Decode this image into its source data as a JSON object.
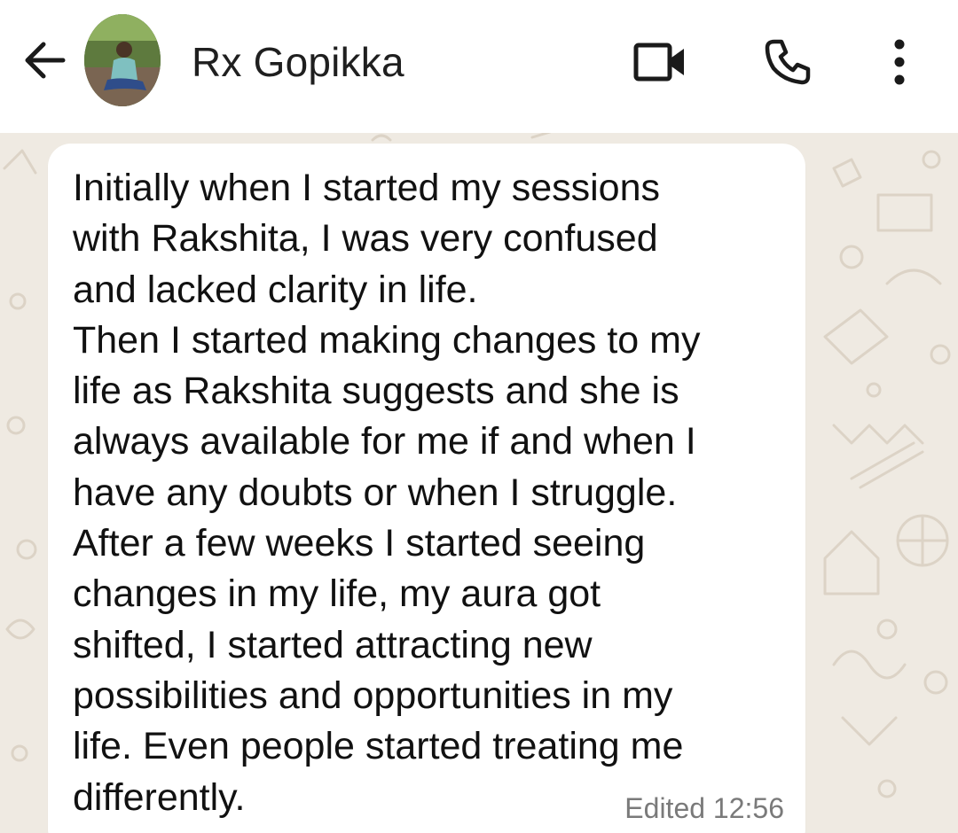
{
  "header": {
    "contact_name": "Rx Gopikka",
    "back_icon": "arrow-left-icon",
    "video_icon": "video-camera-icon",
    "call_icon": "phone-icon",
    "menu_icon": "more-vertical-icon"
  },
  "message": {
    "text": "Initially when I started my sessions\nwith Rakshita, I was very confused\nand lacked clarity in life.\nThen I started making changes to my\nlife as Rakshita suggests and she is\nalways available for me if and when I\nhave any doubts or when I struggle.\nAfter a few weeks I started seeing\nchanges in my life, my aura got\nshifted, I started attracting new\npossibilities and opportunities in my\nlife. Even people started treating me\ndifferently.",
    "edited_label": "Edited",
    "time": "12:56"
  },
  "colors": {
    "header_bg": "#ffffff",
    "chat_bg": "#efeae2",
    "bubble_bg": "#ffffff",
    "meta_text": "#7a7a7a"
  }
}
